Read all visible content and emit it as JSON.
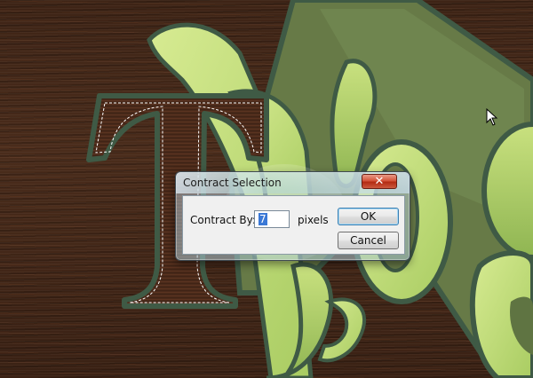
{
  "dialog": {
    "title": "Contract Selection",
    "close_glyph": "✕",
    "field_label": "Contract By:",
    "field_value": "7",
    "units_label": "pixels",
    "ok_label": "OK",
    "cancel_label": "Cancel"
  },
  "colors": {
    "wood_dark": "#3e2416",
    "letter_green_light": "#c3dc7c",
    "letter_green_mid": "#9ec45a",
    "letter_green_dark": "#6b7e4a",
    "outline": "#3f5a45",
    "close_red": "#c8432a"
  },
  "icons": {
    "close": "close-icon",
    "cursor": "mouse-pointer-icon"
  }
}
